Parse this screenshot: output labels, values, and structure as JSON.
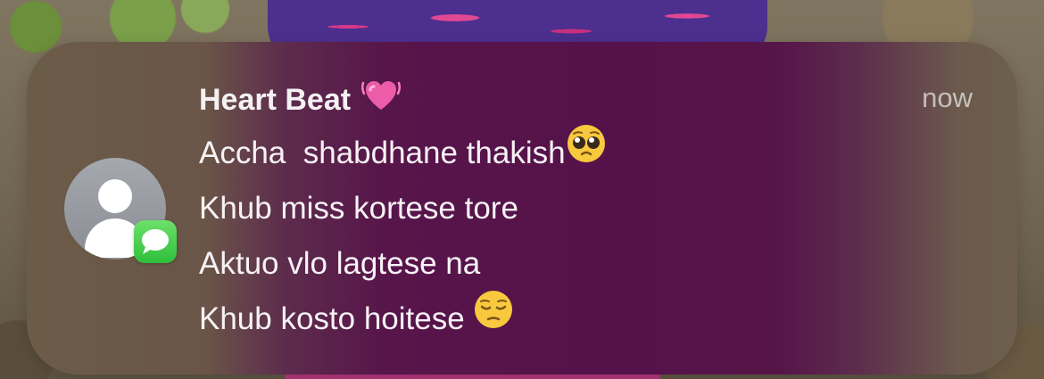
{
  "notification": {
    "sender": "Heart Beat",
    "sender_emoji": "pink-heart-icon",
    "time": "now",
    "app_badge": "messages-icon",
    "avatar": "contact-silhouette-icon",
    "lines": [
      {
        "text": "Accha  shabdhane thakish",
        "emoji": "pleading-face-icon"
      },
      {
        "text": "Khub miss kortese tore",
        "emoji": ""
      },
      {
        "text": "Aktuo vlo lagtese na",
        "emoji": ""
      },
      {
        "text": "Khub kosto hoitese ",
        "emoji": "pensive-face-icon"
      }
    ]
  },
  "colors": {
    "banner_center": "#55124a",
    "banner_edge": "#6b5c48",
    "badge_green": "#34c63f",
    "text": "#f7f2f5",
    "time_text": "#b9aeb5"
  }
}
